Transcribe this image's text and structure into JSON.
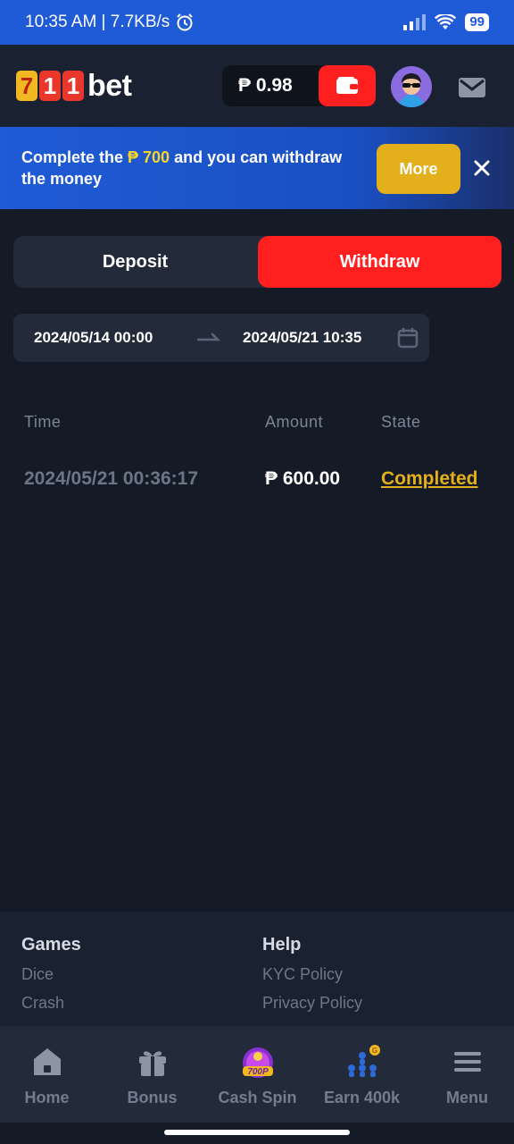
{
  "status_bar": {
    "time_speed": "10:35 AM | 7.7KB/s",
    "battery": "99"
  },
  "header": {
    "logo_digits": [
      "7",
      "1",
      "1"
    ],
    "logo_word": "bet",
    "balance": "₱ 0.98"
  },
  "banner": {
    "text_before": "Complete the ",
    "highlight": "₱ 700",
    "text_after": " and you can withdraw the money",
    "more_label": "More"
  },
  "tabs": [
    {
      "label": "Deposit",
      "active": false
    },
    {
      "label": "Withdraw",
      "active": true
    }
  ],
  "date_range": {
    "start": "2024/05/14 00:00",
    "end": "2024/05/21 10:35"
  },
  "table": {
    "headers": [
      "Time",
      "Amount",
      "State"
    ],
    "rows": [
      {
        "time": "2024/05/21 00:36:17",
        "amount": "₱ 600.00",
        "state": "Completed"
      }
    ]
  },
  "footer": {
    "games_title": "Games",
    "games_links": [
      "Dice",
      "Crash"
    ],
    "help_title": "Help",
    "help_links": [
      "KYC Policy",
      "Privacy Policy"
    ]
  },
  "bottom_nav": [
    {
      "label": "Home",
      "icon": "home-icon"
    },
    {
      "label": "Bonus",
      "icon": "gift-icon"
    },
    {
      "label": "Cash Spin",
      "icon": "cash-spin-icon",
      "badge": "700P"
    },
    {
      "label": "Earn 400k",
      "icon": "referral-icon",
      "badge": "G"
    },
    {
      "label": "Menu",
      "icon": "menu-icon"
    }
  ],
  "colors": {
    "accent_red": "#ff1f1f",
    "gold": "#e3b01c",
    "brand_blue": "#1f5bd6",
    "background": "#151b26"
  }
}
